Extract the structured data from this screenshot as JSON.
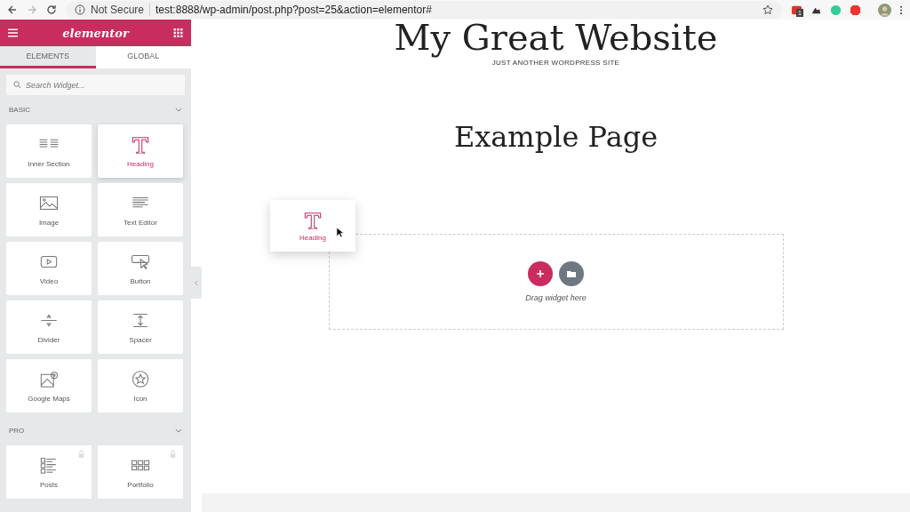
{
  "browser": {
    "security": "Not Secure",
    "url": "test:8888/wp-admin/post.php?post=25&action=elementor#",
    "extension_badge": "1"
  },
  "sidebar": {
    "brand": "elementor",
    "tabs": [
      {
        "label": "ELEMENTS",
        "selected": true
      },
      {
        "label": "GLOBAL",
        "selected": false
      }
    ],
    "search": {
      "placeholder": "Search Widget..."
    },
    "categories": [
      {
        "title": "BASIC",
        "expanded": true,
        "widgets": [
          {
            "label": "Inner Section",
            "kind": "section",
            "selected": false,
            "locked": false
          },
          {
            "label": "Heading",
            "kind": "heading",
            "selected": true,
            "locked": false
          },
          {
            "label": "Image",
            "kind": "image",
            "selected": false,
            "locked": false
          },
          {
            "label": "Text Editor",
            "kind": "text",
            "selected": false,
            "locked": false
          },
          {
            "label": "Video",
            "kind": "video",
            "selected": false,
            "locked": false
          },
          {
            "label": "Button",
            "kind": "button",
            "selected": false,
            "locked": false
          },
          {
            "label": "Divider",
            "kind": "divider",
            "selected": false,
            "locked": false
          },
          {
            "label": "Spacer",
            "kind": "spacer",
            "selected": false,
            "locked": false
          },
          {
            "label": "Google Maps",
            "kind": "map",
            "selected": false,
            "locked": false
          },
          {
            "label": "Icon",
            "kind": "star",
            "selected": false,
            "locked": false
          }
        ]
      },
      {
        "title": "PRO",
        "expanded": true,
        "widgets": [
          {
            "label": "Posts",
            "kind": "posts",
            "selected": false,
            "locked": true
          },
          {
            "label": "Portfolio",
            "kind": "grid",
            "selected": false,
            "locked": true
          }
        ]
      }
    ]
  },
  "canvas": {
    "site_title": "My Great Website",
    "tagline": "JUST ANOTHER WORDPRESS SITE",
    "page_title": "Example Page",
    "dragged_widget": {
      "label": "Heading",
      "kind": "heading"
    },
    "drop_zone": {
      "hint": "Drag widget here"
    }
  }
}
